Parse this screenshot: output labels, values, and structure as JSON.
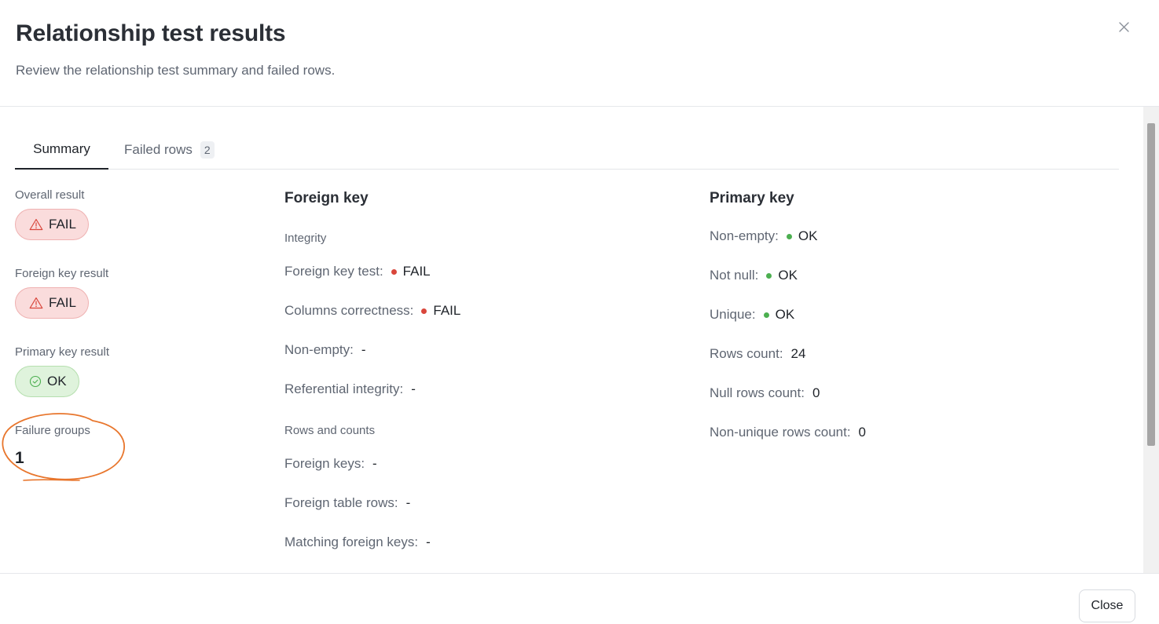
{
  "dialog": {
    "title": "Relationship test results",
    "subtitle": "Review the relationship test summary and failed rows.",
    "close_icon": "close-icon"
  },
  "tabs": [
    {
      "label": "Summary",
      "active": true
    },
    {
      "label": "Failed rows",
      "count": "2",
      "active": false
    }
  ],
  "summary": {
    "overall": {
      "label": "Overall result",
      "value": "FAIL",
      "icon": "warning-triangle-icon"
    },
    "foreign_key": {
      "label": "Foreign key result",
      "value": "FAIL",
      "icon": "warning-triangle-icon"
    },
    "primary_key": {
      "label": "Primary key result",
      "value": "OK",
      "icon": "check-circle-icon"
    },
    "failure_groups": {
      "label": "Failure groups",
      "value": "1"
    }
  },
  "foreign_key_section": {
    "title": "Foreign key",
    "integrity_heading": "Integrity",
    "integrity": [
      {
        "label": "Foreign key test:",
        "value": "FAIL",
        "status": "fail"
      },
      {
        "label": "Columns correctness:",
        "value": "FAIL",
        "status": "fail"
      },
      {
        "label": "Non-empty:",
        "value": "-"
      },
      {
        "label": "Referential integrity:",
        "value": "-"
      }
    ],
    "counts_heading": "Rows and counts",
    "counts": [
      {
        "label": "Foreign keys:",
        "value": "-"
      },
      {
        "label": "Foreign table rows:",
        "value": "-"
      },
      {
        "label": "Matching foreign keys:",
        "value": "-"
      }
    ]
  },
  "primary_key_section": {
    "title": "Primary key",
    "rows": [
      {
        "label": "Non-empty:",
        "value": "OK",
        "status": "ok"
      },
      {
        "label": "Not null:",
        "value": "OK",
        "status": "ok"
      },
      {
        "label": "Unique:",
        "value": "OK",
        "status": "ok"
      },
      {
        "label": "Rows count:",
        "value": "24"
      },
      {
        "label": "Null rows count:",
        "value": "0"
      },
      {
        "label": "Non-unique rows count:",
        "value": "0"
      }
    ]
  },
  "footer": {
    "close_label": "Close"
  },
  "colors": {
    "fail_dot": "#d9463b",
    "ok_dot": "#4caf50",
    "annotation": "#e8762d"
  }
}
